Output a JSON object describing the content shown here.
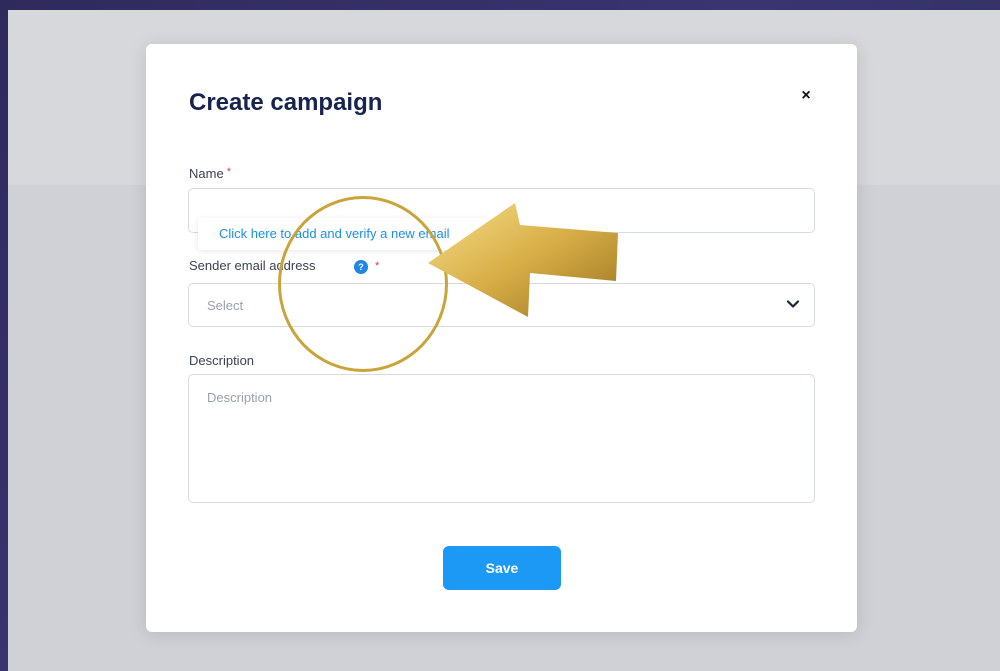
{
  "modal": {
    "title": "Create campaign",
    "close_glyph": "×",
    "fields": {
      "name": {
        "label": "Name",
        "required_marker": "*",
        "value": ""
      },
      "sender_email": {
        "label": "Sender email address",
        "required_marker": "*",
        "placeholder": "Select",
        "info_glyph": "?"
      },
      "description": {
        "label": "Description",
        "placeholder": "Description"
      }
    },
    "tooltip_link": "Click here to add and verify a new email",
    "save_label": "Save"
  },
  "colors": {
    "accent": "#1c98f5",
    "title": "#16244f",
    "required": "#e0383e",
    "highlight": "#c9a43a"
  },
  "icons": {
    "close": "close-icon",
    "info": "info-icon",
    "dropdown": "chevron-down-icon",
    "annotation": "arrow-icon"
  }
}
